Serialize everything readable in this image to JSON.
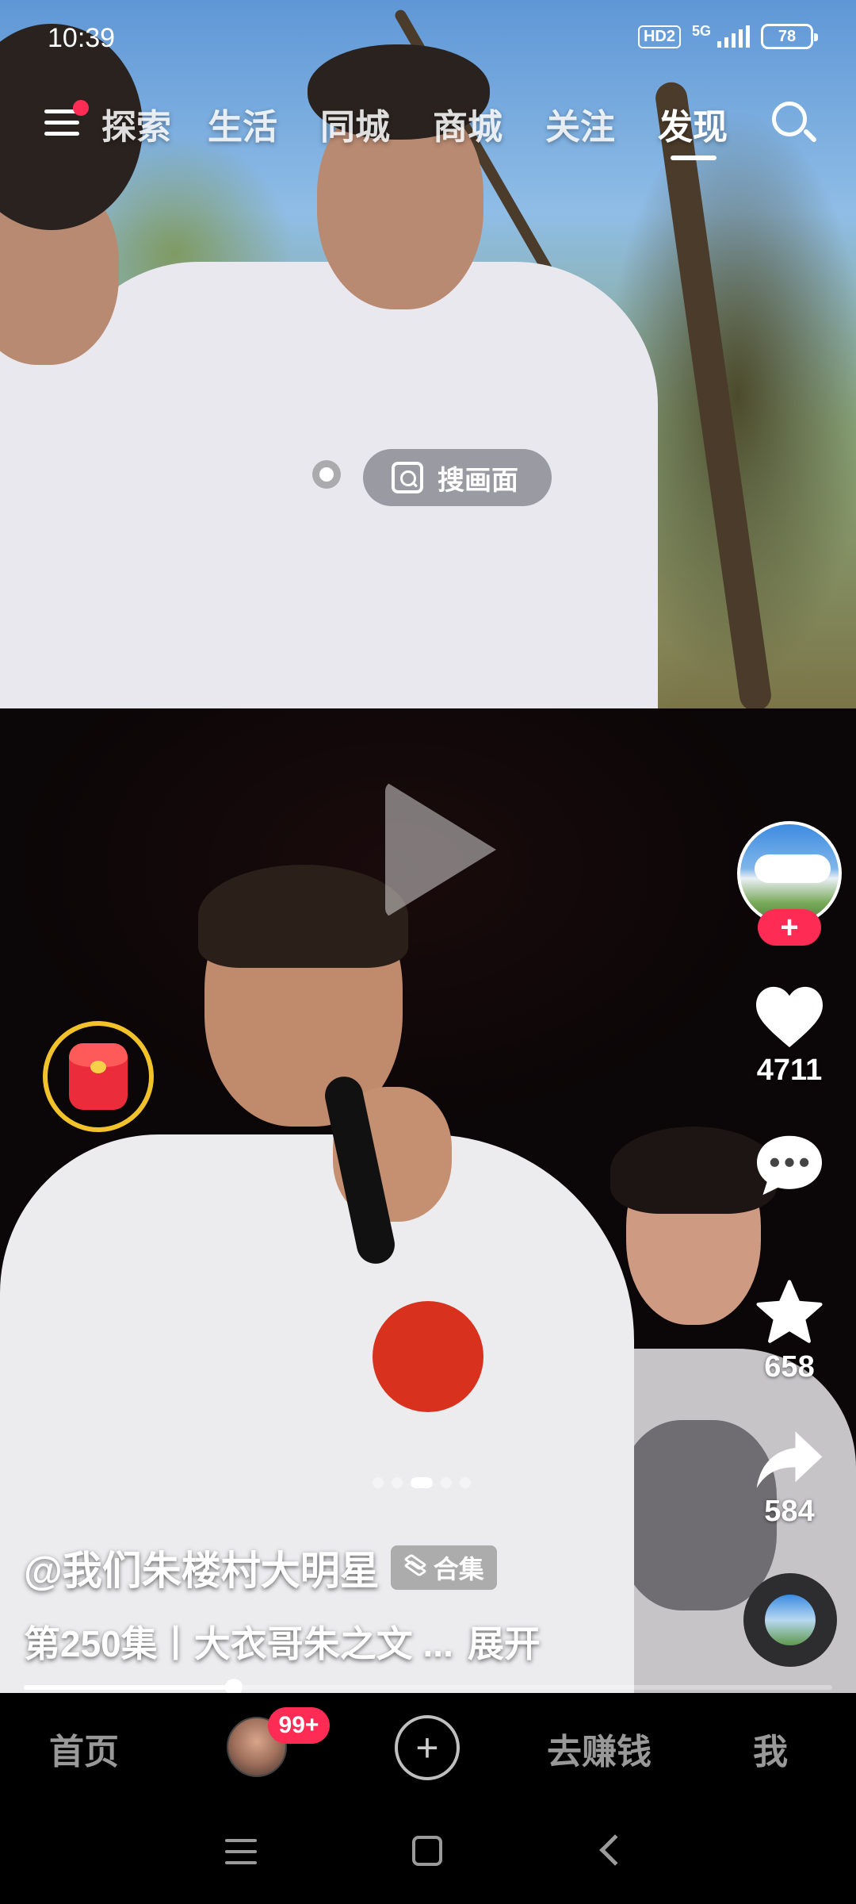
{
  "status_bar": {
    "time": "10:39",
    "hd_label": "HD2",
    "network": "5G",
    "battery": "78"
  },
  "top_nav": {
    "tabs": [
      {
        "label": "探索",
        "active": false
      },
      {
        "label": "生活",
        "active": false
      },
      {
        "label": "同城",
        "active": false
      },
      {
        "label": "商城",
        "active": false
      },
      {
        "label": "关注",
        "active": false
      },
      {
        "label": "发现",
        "active": true
      }
    ]
  },
  "search_frame": {
    "label": "搜画面"
  },
  "actions": {
    "likes": "4711",
    "favorites": "658",
    "shares": "584"
  },
  "caption": {
    "author": "@我们朱楼村大明星",
    "collection_label": "合集",
    "episode": "第250集丨大衣哥朱之文 ...",
    "expand": "展开"
  },
  "pager": {
    "count": 5,
    "active_index": 2
  },
  "progress": {
    "fraction": 0.26
  },
  "bottom_nav": {
    "home": "首页",
    "badge": "99+",
    "earn": "去赚钱",
    "me": "我"
  },
  "colors": {
    "accent": "#fe2c55",
    "redpacket_ring": "#f2c22a"
  }
}
